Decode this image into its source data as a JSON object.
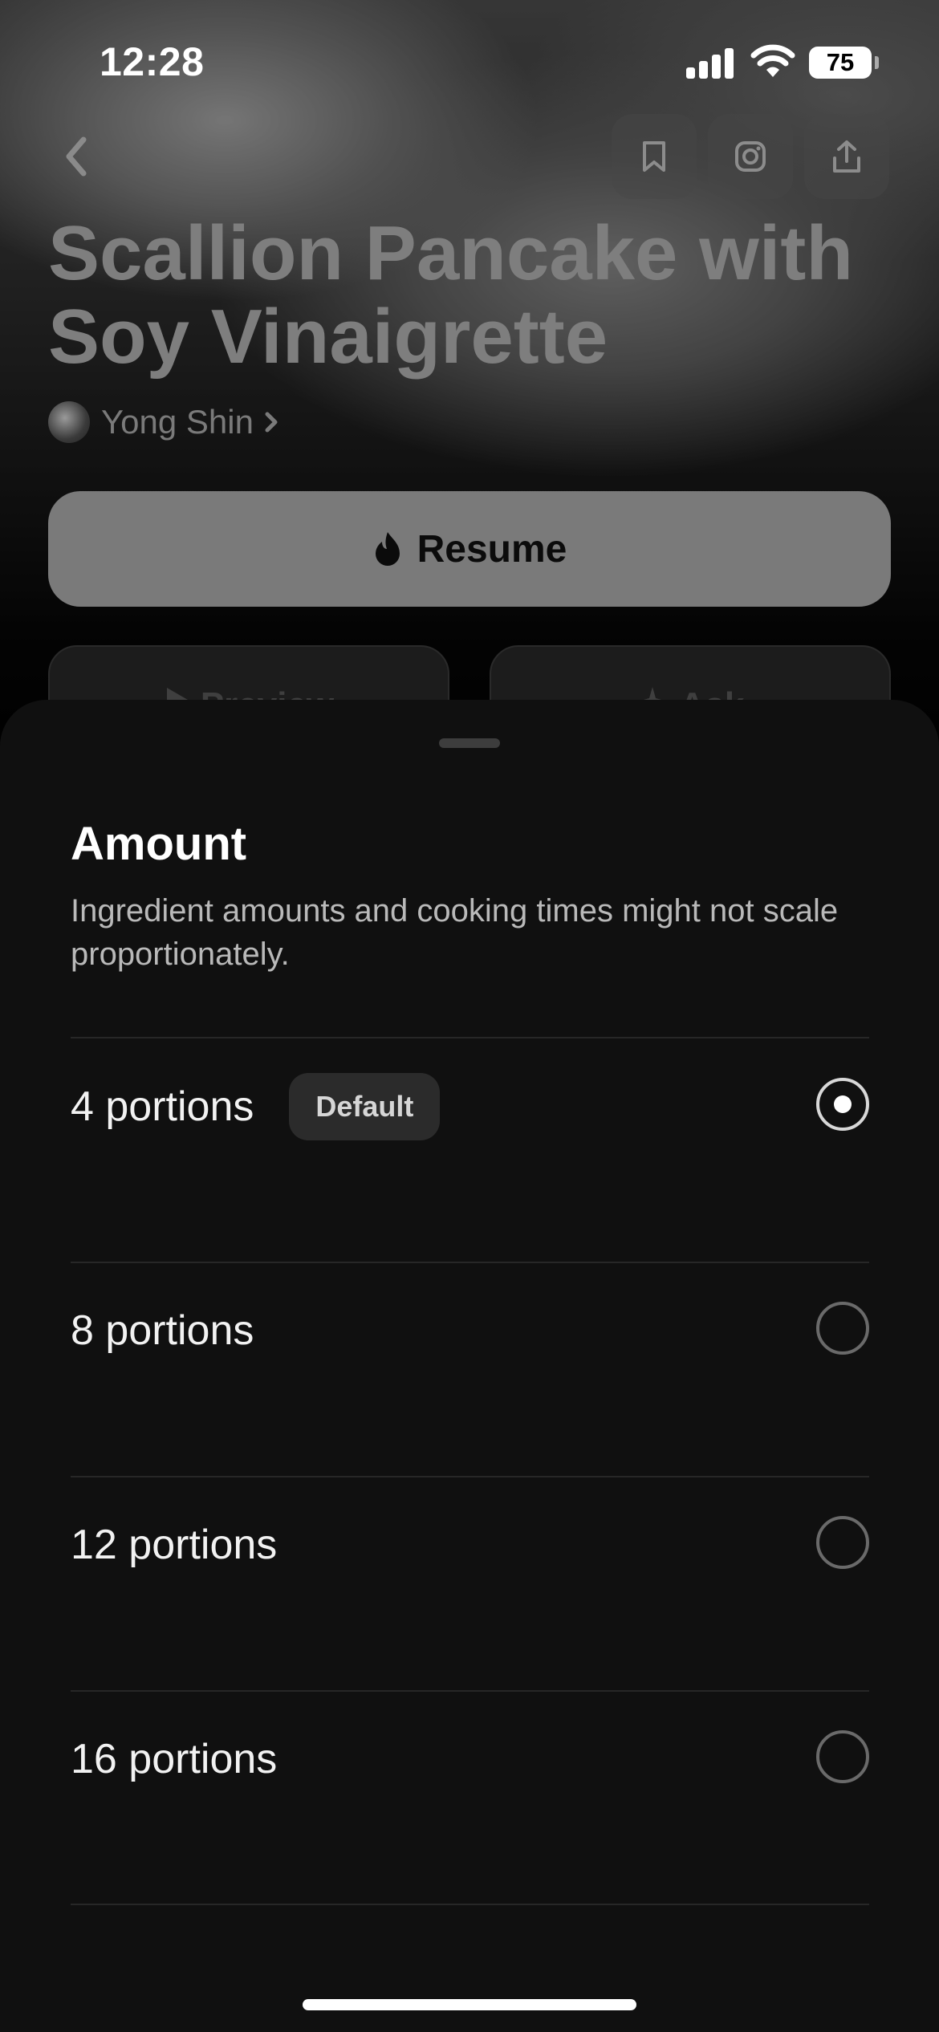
{
  "status_bar": {
    "time": "12:28",
    "battery": "75"
  },
  "recipe": {
    "title": "Scallion Pancake with Soy Vinaigrette",
    "author": "Yong Shin",
    "resume_label": "Resume",
    "preview_label": "Preview",
    "ask_label": "Ask"
  },
  "sheet": {
    "title": "Amount",
    "description": "Ingredient amounts and cooking times might not scale proportionately.",
    "options": [
      {
        "label": "4 portions",
        "badge": "Default",
        "selected": true
      },
      {
        "label": "8 portions",
        "selected": false
      },
      {
        "label": "12 portions",
        "selected": false
      },
      {
        "label": "16 portions",
        "selected": false
      }
    ]
  }
}
